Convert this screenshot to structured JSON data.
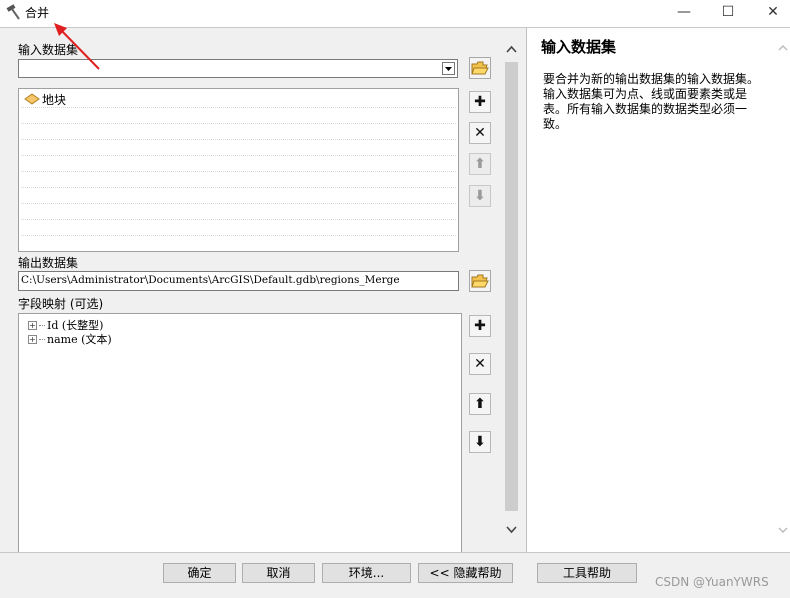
{
  "window": {
    "title": "合并",
    "minimize": "—",
    "maximize": "☐",
    "close": "✕"
  },
  "input_dataset": {
    "label": "输入数据集",
    "value": "",
    "items": [
      "地块"
    ]
  },
  "output_dataset": {
    "label": "输出数据集",
    "value": "C:\\Users\\Administrator\\Documents\\ArcGIS\\Default.gdb\\regions_Merge"
  },
  "field_mapping": {
    "label": "字段映射 (可选)",
    "fields": [
      "Id (长整型)",
      "name (文本)"
    ]
  },
  "help": {
    "title": "输入数据集",
    "body": "要合并为新的输出数据集的输入数据集。输入数据集可为点、线或面要素类或是表。所有输入数据集的数据类型必须一致。"
  },
  "buttons": {
    "ok": "确定",
    "cancel": "取消",
    "environments": "环境...",
    "hide_help": "<< 隐藏帮助",
    "tool_help": "工具帮助"
  },
  "watermark": "CSDN @YuanYWRS",
  "colors": {
    "annotation_arrow": "#e02020",
    "layer_icon": "#f5c66b"
  }
}
